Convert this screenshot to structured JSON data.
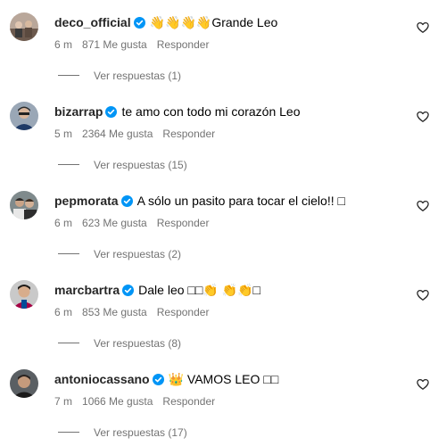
{
  "colors": {
    "verified_badge": "#0095f6",
    "secondary_text": "#737373",
    "username": "#262626"
  },
  "comments": [
    {
      "username": "deco_official",
      "text": "👋👋👋👋Grande Leo",
      "time": "6 m",
      "likes": "871 Me gusta",
      "reply": "Responder",
      "view_replies": "Ver respuestas (1)"
    },
    {
      "username": "bizarrap",
      "text": "te amo con todo mi corazón Leo",
      "time": "5 m",
      "likes": "2364 Me gusta",
      "reply": "Responder",
      "view_replies": "Ver respuestas (15)"
    },
    {
      "username": "pepmorata",
      "text": "A sólo un pasito para tocar el cielo!! □",
      "time": "6 m",
      "likes": "623 Me gusta",
      "reply": "Responder",
      "view_replies": "Ver respuestas (2)"
    },
    {
      "username": "marcbartra",
      "text": "Dale leo □□👏 👏👏□",
      "time": "6 m",
      "likes": "853 Me gusta",
      "reply": "Responder",
      "view_replies": "Ver respuestas (8)"
    },
    {
      "username": "antoniocassano",
      "text": "👑 VAMOS LEO □□",
      "time": "7 m",
      "likes": "1066 Me gusta",
      "reply": "Responder",
      "view_replies": "Ver respuestas (17)"
    }
  ]
}
